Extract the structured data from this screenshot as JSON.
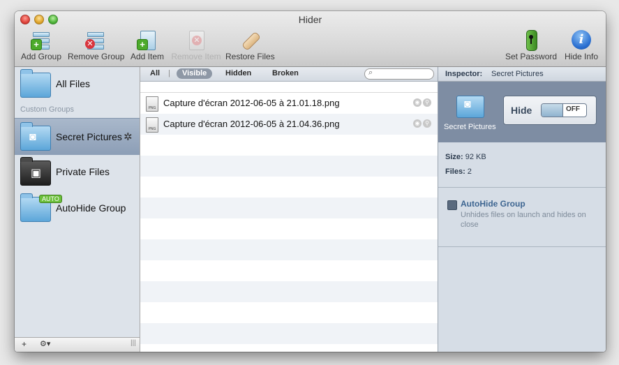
{
  "window": {
    "title": "Hider"
  },
  "toolbar": {
    "add_group": "Add Group",
    "remove_group": "Remove Group",
    "add_item": "Add Item",
    "remove_item": "Remove Item",
    "restore_files": "Restore Files",
    "set_password": "Set Password",
    "hide_info": "Hide Info"
  },
  "sidebar": {
    "all_files": "All Files",
    "custom_groups_header": "Custom Groups",
    "items": [
      {
        "label": "Secret Pictures",
        "icon": "camera-folder-icon"
      },
      {
        "label": "Private Files",
        "icon": "lock-folder-icon"
      },
      {
        "label": "AutoHide Group",
        "icon": "auto-folder-icon",
        "badge": "AUTO"
      }
    ],
    "bottom": {
      "add": "+",
      "action": "⚙▾",
      "resize": "|||"
    }
  },
  "filters": {
    "all": "All",
    "visible": "Visible",
    "hidden": "Hidden",
    "broken": "Broken",
    "selected": "Visible"
  },
  "files": [
    {
      "name": "Capture d'écran 2012-06-05 à 21.01.18.png",
      "type": "PNG"
    },
    {
      "name": "Capture d'écran 2012-06-05 à 21.04.36.png",
      "type": "PNG"
    }
  ],
  "inspector": {
    "label": "Inspector:",
    "group_name": "Secret Pictures",
    "hide_label": "Hide",
    "toggle_state": "OFF",
    "size_label": "Size:",
    "size_value": "92 KB",
    "files_label": "Files:",
    "files_value": "2",
    "autohide_title": "AutoHide Group",
    "autohide_desc": "Unhides files on launch and hides on close"
  },
  "colors": {
    "selection": "#9aabc1",
    "inspector_header": "#7e8da3",
    "link": "#3d6591"
  }
}
